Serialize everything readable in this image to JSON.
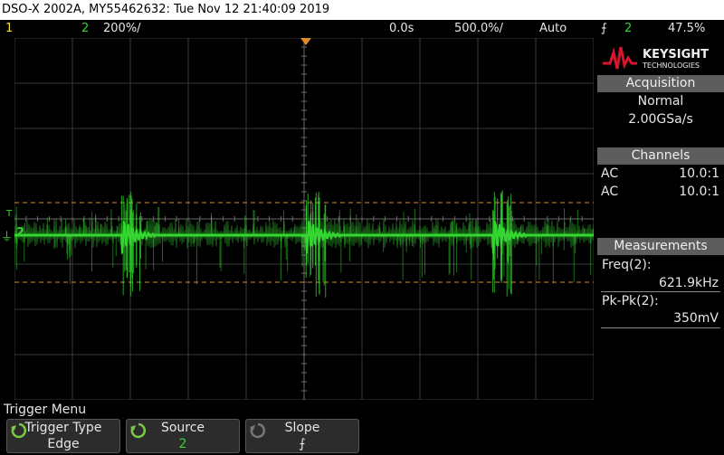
{
  "window": {
    "title": "DSO-X 2002A, MY55462632: Tue Nov 12 21:40:09 2019"
  },
  "status_bar": {
    "ch1_label": "1",
    "ch2_label": "2",
    "ch2_scale": "200%/",
    "time_delay": "0.0s",
    "time_scale": "500.0%/",
    "trigger_mode": "Auto",
    "trigger_slope_symbol": "⨍",
    "trigger_source": "2",
    "trigger_level": "47.5%"
  },
  "brand": {
    "name": "KEYSIGHT",
    "sub": "TECHNOLOGIES",
    "logo_color": "#d7152c"
  },
  "acquisition": {
    "header": "Acquisition",
    "mode": "Normal",
    "sample_rate": "2.00GSa/s"
  },
  "channels": {
    "header": "Channels",
    "rows": [
      {
        "coupling": "AC",
        "probe": "10.0:1",
        "color": "#f2e522"
      },
      {
        "coupling": "AC",
        "probe": "10.0:1",
        "color": "#35d631"
      }
    ]
  },
  "measurements": {
    "header": "Measurements",
    "items": [
      {
        "label": "Freq(2):",
        "value": "621.9kHz"
      },
      {
        "label": "Pk-Pk(2):",
        "value": "350mV"
      }
    ]
  },
  "screen": {
    "trace_color": "#35d631",
    "trigger_line_color": "#e08a2c",
    "marker_t": "T",
    "marker_2": "2"
  },
  "trigger_menu": {
    "title": "Trigger Menu",
    "softkeys": [
      {
        "label": "Trigger Type",
        "value": "Edge",
        "knob": true
      },
      {
        "label": "Source",
        "value": "2",
        "knob": true
      },
      {
        "label": "Slope",
        "value": "⨍",
        "knob": true
      }
    ]
  }
}
